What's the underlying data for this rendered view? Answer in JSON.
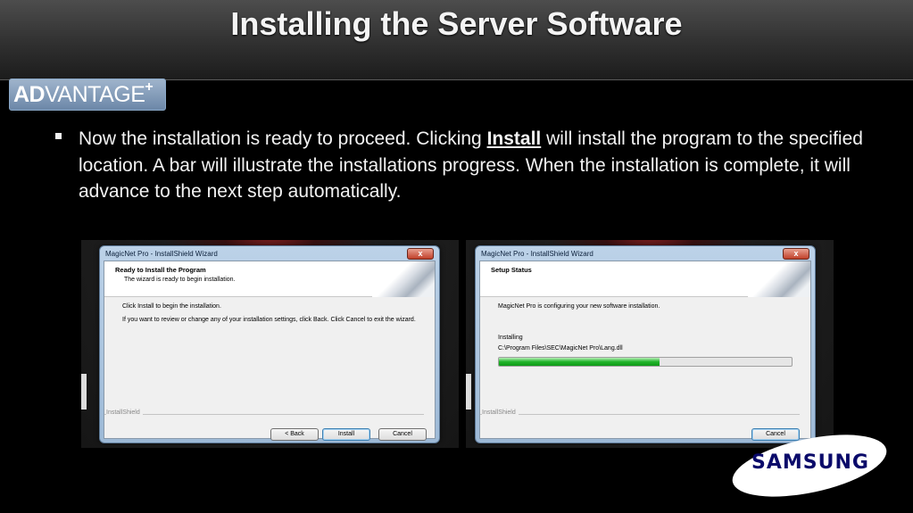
{
  "slide": {
    "title": "Installing the Server Software",
    "logo": {
      "ad": "AD",
      "vantage": "VANTAGE",
      "plus": "+"
    },
    "bullet": {
      "before": "Now the installation is ready to proceed. Clicking ",
      "keyword": "Install",
      "after": " will install the program to the specified location. A bar will illustrate the installations progress. When the installation is complete, it will advance to the next step automatically."
    },
    "brand": "SAMSUNG"
  },
  "wizard_ready": {
    "window_title": "MagicNet Pro - InstallShield Wizard",
    "close_label": "x",
    "header_title": "Ready to Install the Program",
    "header_subtitle": "The wizard is ready to begin installation.",
    "line1": "Click Install to begin the installation.",
    "line2": "If you want to review or change any of your installation settings, click Back. Click Cancel to exit the wizard.",
    "installshield": "InstallShield",
    "back_label": "< Back",
    "install_label": "Install",
    "cancel_label": "Cancel"
  },
  "wizard_status": {
    "window_title": "MagicNet Pro - InstallShield Wizard",
    "close_label": "x",
    "header_title": "Setup Status",
    "line1": "MagicNet Pro is configuring your new software installation.",
    "status_label": "Installing",
    "file_path": "C:\\Program Files\\SEC\\MagicNet Pro\\Lang.dll",
    "progress_fraction": 0.55,
    "installshield": "InstallShield",
    "cancel_label": "Cancel"
  },
  "colors": {
    "progress_green": "#21b42a",
    "samsung_blue": "#0a0a6a"
  }
}
